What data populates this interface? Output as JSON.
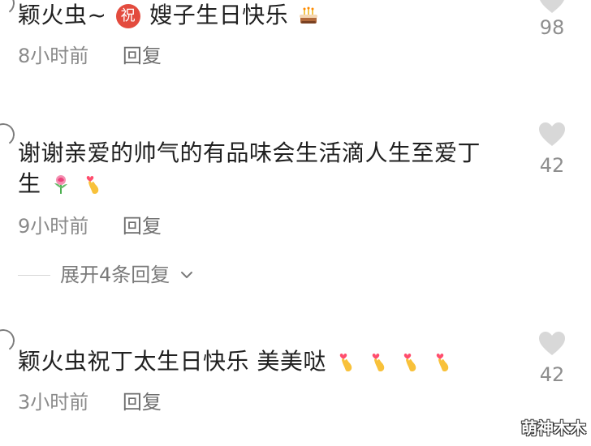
{
  "comments": [
    {
      "text_prefix": "颖火虫~",
      "badge": "祝",
      "text_suffix": "嫂子生日快乐",
      "emojis": [
        "cake-emoji"
      ],
      "time": "8小时前",
      "reply_label": "回复",
      "likes": "98",
      "heart_icon": "heart-icon"
    },
    {
      "line1": "谢谢亲爱的帅气的有品味会生活滴人生至爱丁",
      "line2": "生",
      "emojis": [
        "rose-emoji",
        "finger-heart-emoji"
      ],
      "time": "9小时前",
      "reply_label": "回复",
      "likes": "42",
      "heart_icon": "heart-icon"
    },
    {
      "text": "颖火虫祝丁太生日快乐 美美哒",
      "emojis": [
        "finger-heart-emoji",
        "finger-heart-emoji",
        "finger-heart-emoji",
        "finger-heart-emoji"
      ],
      "time": "3小时前",
      "reply_label": "回复",
      "likes": "42",
      "heart_icon": "heart-icon"
    }
  ],
  "expand_replies": {
    "label": "展开4条回复",
    "icon": "chevron-down-icon"
  },
  "watermark": "萌神木木",
  "colors": {
    "text": "#202020",
    "meta": "#8a8a8a",
    "like": "#8e8e8e",
    "badge": "#e34b3e",
    "heart": "#d8d8d8"
  }
}
